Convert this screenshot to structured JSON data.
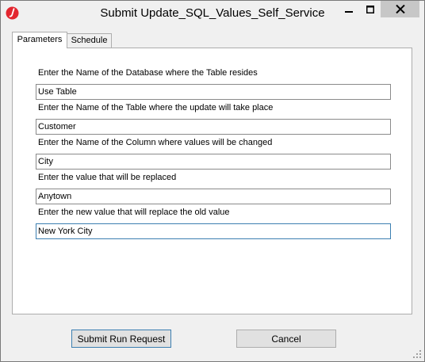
{
  "window": {
    "title": "Submit Update_SQL_Values_Self_Service"
  },
  "tabs": [
    {
      "label": "Parameters",
      "active": true
    },
    {
      "label": "Schedule",
      "active": false
    }
  ],
  "fields": [
    {
      "label": "Enter the Name of the Database where the Table resides",
      "value": "Use Table"
    },
    {
      "label": "Enter the Name of the Table where the update will take place",
      "value": "Customer"
    },
    {
      "label": "Enter the Name of the Column where values will be changed",
      "value": "City"
    },
    {
      "label": "Enter the value that will be replaced",
      "value": "Anytown"
    },
    {
      "label": "Enter the new value that will replace the old value",
      "value": "New York City"
    }
  ],
  "buttons": {
    "submit_label": "Submit Run Request",
    "cancel_label": "Cancel"
  },
  "colors": {
    "app_icon": "#e3262f",
    "focus_border": "#3c7fb1"
  }
}
